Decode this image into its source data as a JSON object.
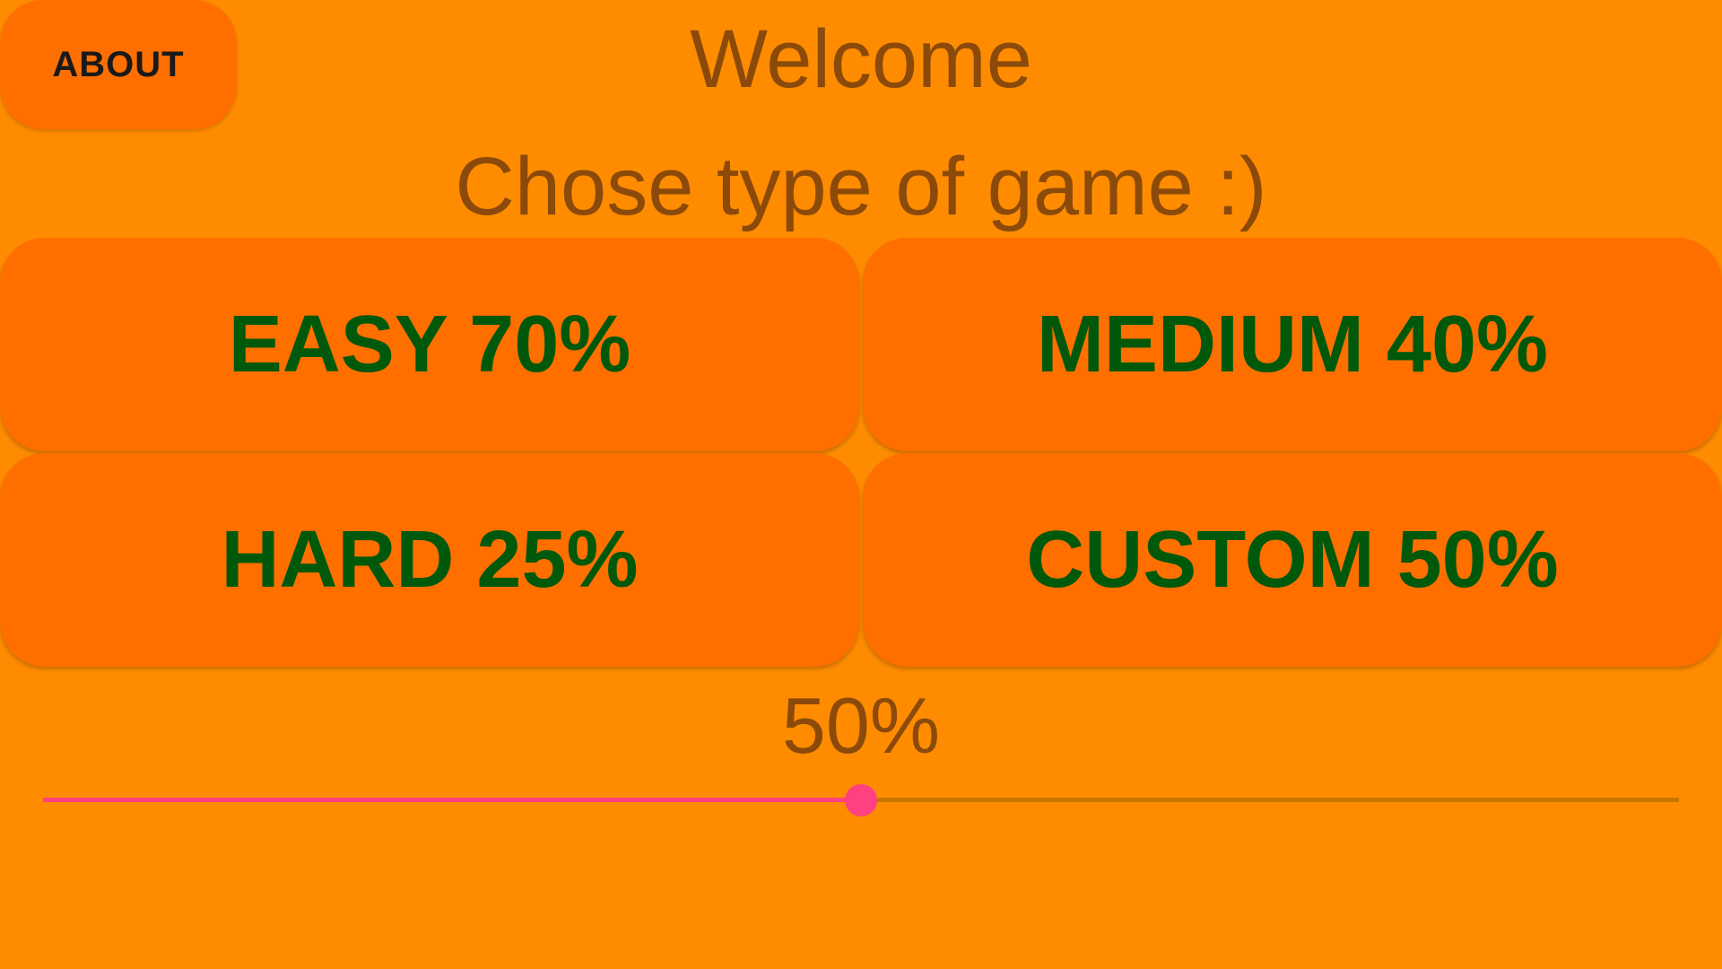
{
  "header": {
    "about_label": "ABOUT",
    "welcome": "Welcome",
    "subtitle": "Chose type of game :)"
  },
  "game_types": [
    {
      "label": "EASY 70%"
    },
    {
      "label": "MEDIUM 40%"
    },
    {
      "label": "HARD 25%"
    },
    {
      "label": "CUSTOM 50%"
    }
  ],
  "custom": {
    "percent_label": "50%",
    "slider_value": 0.5
  },
  "colors": {
    "background": "#FF8C00",
    "button": "#FF6F00",
    "button_text": "#00580A",
    "heading_text": "#8B4A0A",
    "slider_accent": "#FF4081",
    "slider_track": "#C77700"
  }
}
